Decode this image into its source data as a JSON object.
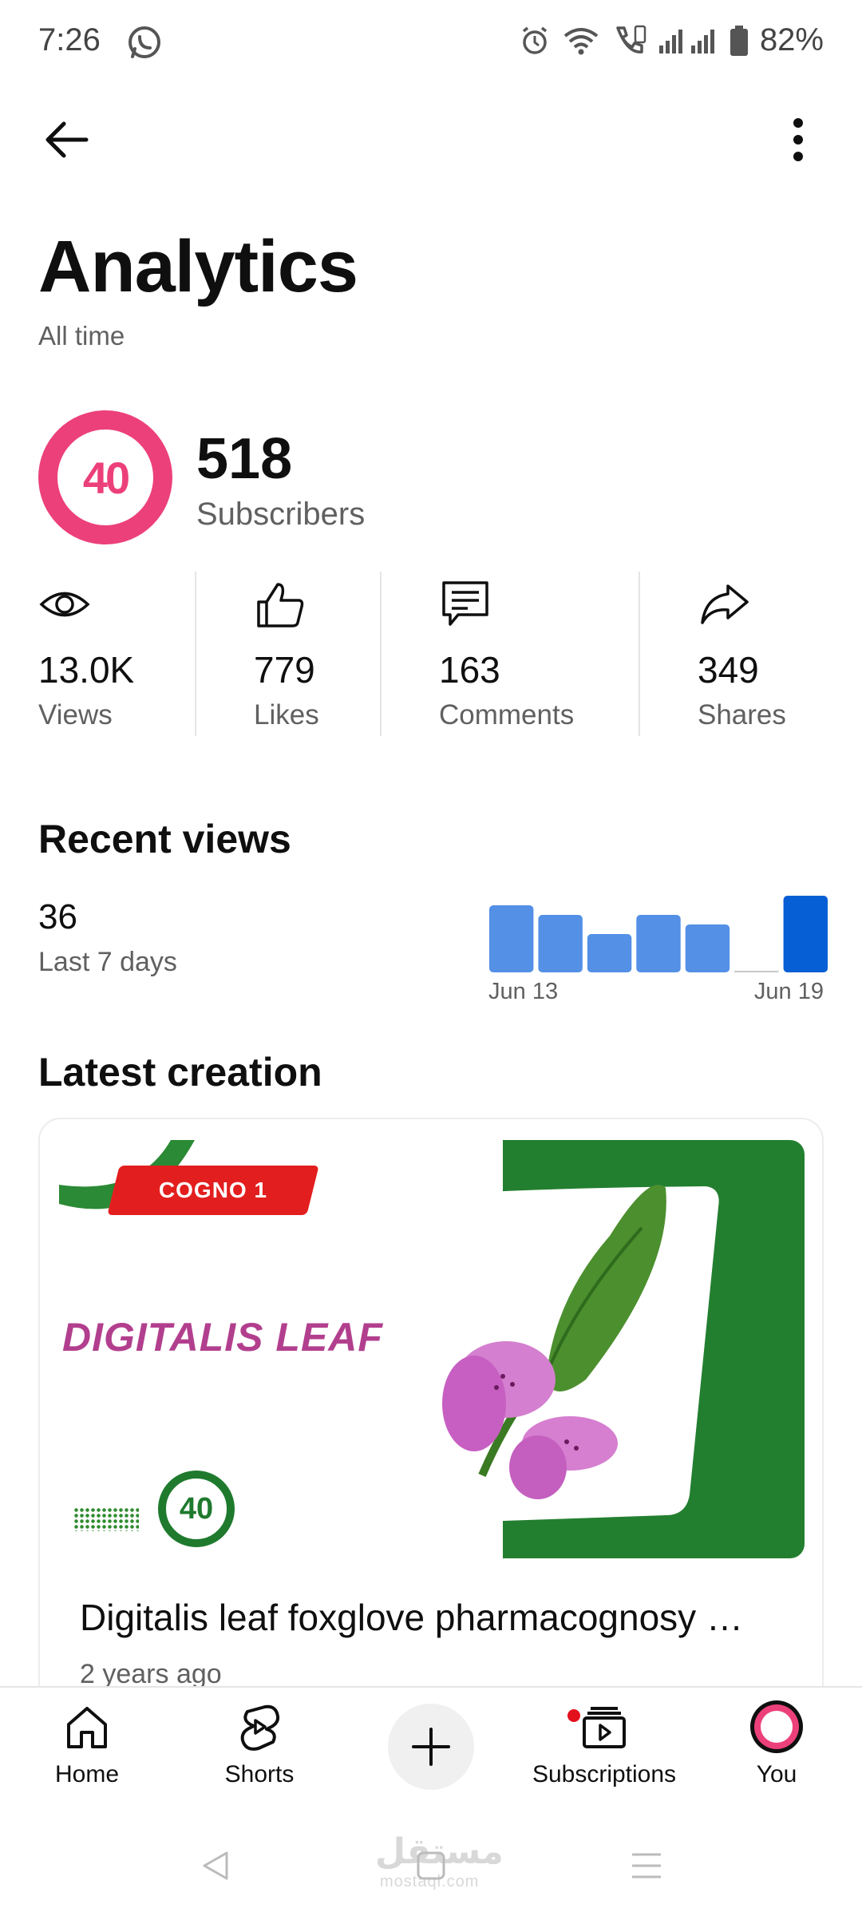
{
  "status_bar": {
    "time": "7:26",
    "battery": "82%",
    "icons": [
      "whatsapp-icon",
      "alarm-icon",
      "wifi-icon",
      "call-icon",
      "signal-icon",
      "battery-icon"
    ]
  },
  "header": {
    "back_icon": "arrow-left-icon",
    "more_icon": "more-vert-icon",
    "title": "Analytics",
    "subtitle": "All time"
  },
  "channel": {
    "avatar_text": "40",
    "subscribers": "518",
    "subscribers_label": "Subscribers"
  },
  "stats": [
    {
      "icon": "eye-icon",
      "value": "13.0K",
      "label": "Views"
    },
    {
      "icon": "thumbs-up-icon",
      "value": "779",
      "label": "Likes"
    },
    {
      "icon": "comment-icon",
      "value": "163",
      "label": "Comments"
    },
    {
      "icon": "share-icon",
      "value": "349",
      "label": "Shares"
    }
  ],
  "recent_views": {
    "title": "Recent views",
    "count": "36",
    "period": "Last 7 days",
    "start_label": "Jun 13",
    "end_label": "Jun 19"
  },
  "chart_data": {
    "type": "bar",
    "categories": [
      "Jun 13",
      "",
      "",
      "",
      "",
      "",
      "Jun 19"
    ],
    "values": [
      7,
      6,
      4,
      6,
      5,
      0,
      8
    ],
    "highlight_index": 6,
    "colors": {
      "default": "#5390e6",
      "highlight": "#065fd4",
      "zero": "#c8c8c8"
    }
  },
  "latest_creation": {
    "title": "Latest creation",
    "thumbnail": {
      "tag": "COGNO 1",
      "headline": "DIGITALIS LEAF",
      "badge": "40"
    },
    "video_title": "Digitalis leaf foxglove pharmacognosy …",
    "meta": "2 years ago"
  },
  "bottom_nav": {
    "items": [
      {
        "label": "Home",
        "icon": "home-icon"
      },
      {
        "label": "Shorts",
        "icon": "shorts-icon"
      },
      {
        "label": "",
        "icon": "plus-icon"
      },
      {
        "label": "Subscriptions",
        "icon": "subscriptions-icon"
      },
      {
        "label": "You",
        "icon": "avatar-icon"
      }
    ]
  },
  "watermark": {
    "text": "مستقل",
    "sub": "mostaql.com"
  },
  "colors": {
    "accent_pink": "#ec407a",
    "youtube_red": "#e3101d",
    "chart_blue": "#5390e6",
    "green": "#1f7a2e"
  }
}
